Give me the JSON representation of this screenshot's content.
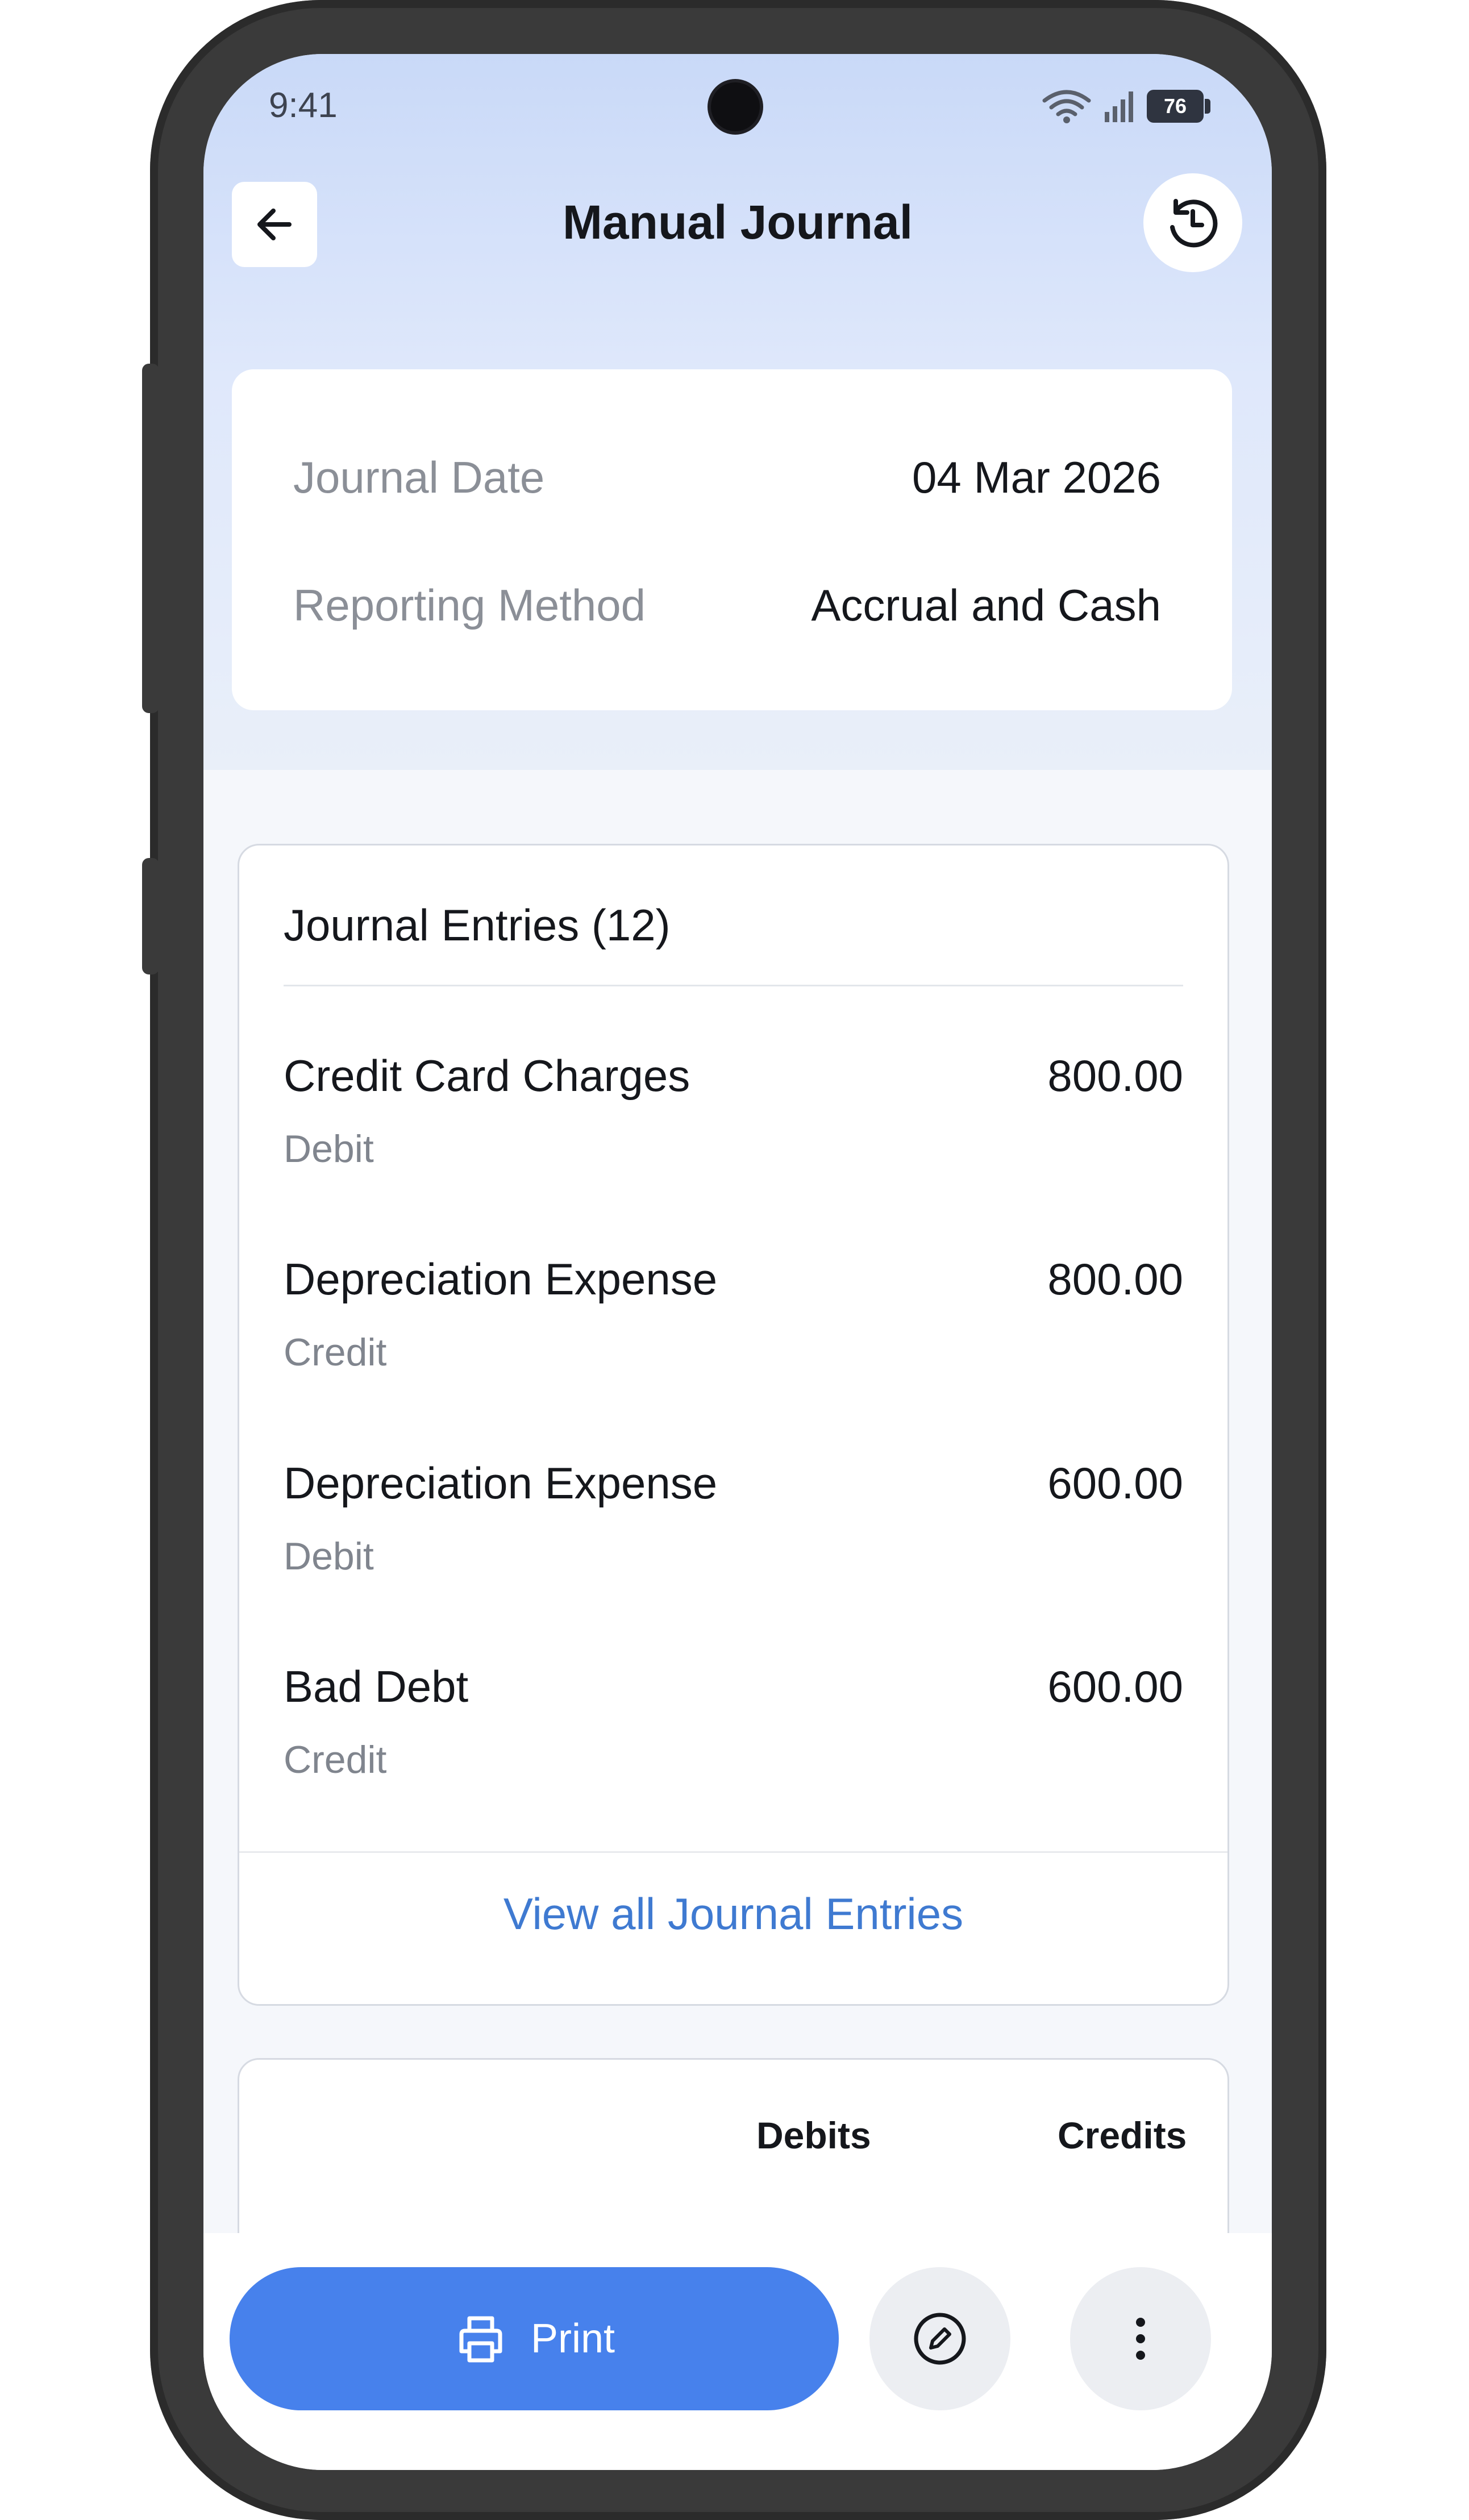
{
  "status_bar": {
    "time": "9:41",
    "battery": "76"
  },
  "header": {
    "title": "Manual Journal"
  },
  "icons": {
    "back": "arrow-left-icon",
    "history": "history-clock-icon",
    "print": "printer-icon",
    "edit": "pencil-icon",
    "more": "more-vertical-icon"
  },
  "info": {
    "journal_date_label": "Journal Date",
    "journal_date_value": "04 Mar 2026",
    "reporting_method_label": "Reporting Method",
    "reporting_method_value": "Accrual and Cash"
  },
  "entries": {
    "title": "Journal Entries (12)",
    "items": [
      {
        "name": "Credit Card Charges",
        "type": "Debit",
        "amount": "800.00"
      },
      {
        "name": "Depreciation Expense",
        "type": "Credit",
        "amount": "800.00"
      },
      {
        "name": "Depreciation Expense",
        "type": "Debit",
        "amount": "600.00"
      },
      {
        "name": "Bad Debt",
        "type": "Credit",
        "amount": "600.00"
      }
    ],
    "view_all": "View all Journal Entries"
  },
  "totals": {
    "debits_header": "Debits",
    "credits_header": "Credits"
  },
  "actions": {
    "print_label": "Print"
  },
  "colors": {
    "accent": "#4781ec",
    "link": "#3f7ad1",
    "header_gradient_top": "#c9d9f8"
  }
}
